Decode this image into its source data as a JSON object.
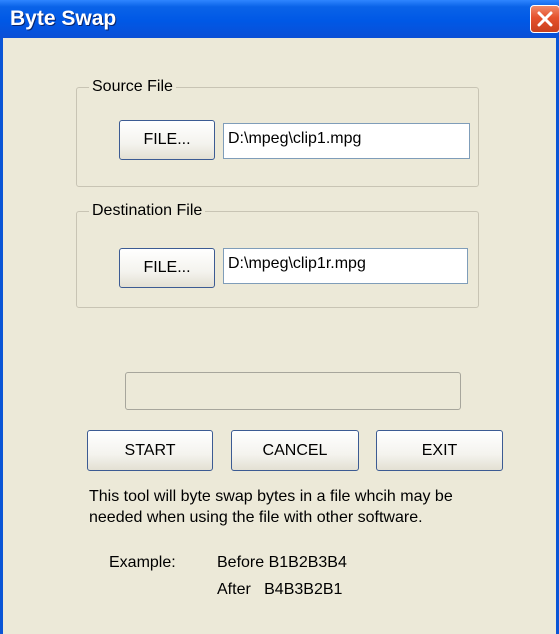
{
  "window": {
    "title": "Byte Swap"
  },
  "source": {
    "group_label": "Source File",
    "button_label": "FILE...",
    "path_value": "D:\\mpeg\\clip1.mpg"
  },
  "destination": {
    "group_label": "Destination File",
    "button_label": "FILE...",
    "path_value": "D:\\mpeg\\clip1r.mpg"
  },
  "progress": {
    "percent": 0
  },
  "actions": {
    "start_label": "START",
    "cancel_label": "CANCEL",
    "exit_label": "EXIT"
  },
  "info": {
    "line1": "This tool will byte swap bytes in a file whcih may be",
    "line2": "needed when using the file with other software.",
    "example_label": "Example:",
    "before_text": "Before B1B2B3B4",
    "after_text": "After   B4B3B2B1"
  },
  "colors": {
    "title_bar": "#0058e6",
    "window_face": "#ece9d8",
    "close_button": "#e5512c"
  },
  "icons": {
    "close": "close-icon"
  }
}
